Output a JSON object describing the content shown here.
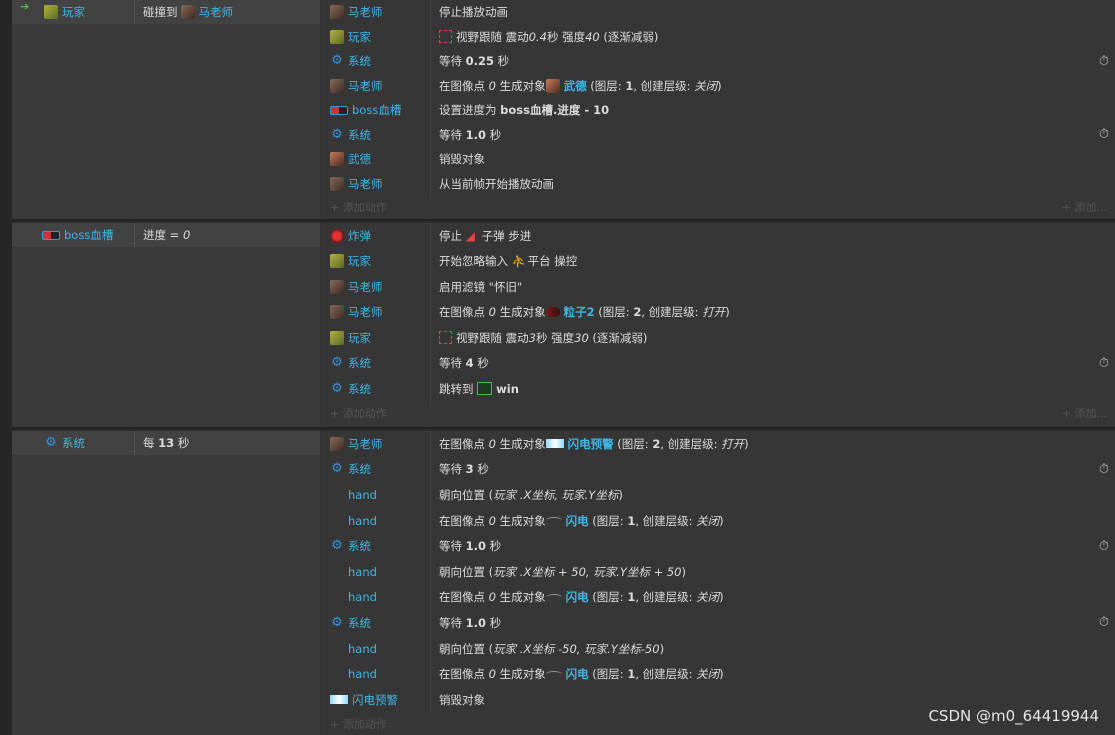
{
  "events": [
    {
      "trigger_object": "玩家",
      "condition_prefix": "碰撞到",
      "condition_object": "马老师",
      "actions": [
        {
          "object": "马老师",
          "icon": "teacher-icon",
          "parts": [
            {
              "t": "停止播放动画"
            }
          ]
        },
        {
          "object": "玩家",
          "icon": "player-icon",
          "parts": [
            {
              "t": "视野跟随 震动"
            },
            {
              "t": "0.4",
              "i": true
            },
            {
              "t": "秒 强度"
            },
            {
              "t": "40",
              "i": true
            },
            {
              "t": " (逐渐减弱)"
            }
          ],
          "lead_icon": "shake-icon"
        },
        {
          "object": "系统",
          "icon": "gear-icon",
          "parts": [
            {
              "t": "等待 "
            },
            {
              "t": "0.25",
              "b": true
            },
            {
              "t": " 秒"
            }
          ],
          "timer": true
        },
        {
          "object": "马老师",
          "icon": "teacher-icon",
          "parts": [
            {
              "t": "在图像点 "
            },
            {
              "t": "0",
              "i": true
            },
            {
              "t": " 生成对象"
            },
            {
              "t": "武德",
              "o": true,
              "icon": "wude-icon"
            },
            {
              "t": " (图层: "
            },
            {
              "t": "1",
              "b": true
            },
            {
              "t": ", 创建层级: "
            },
            {
              "t": "关闭",
              "i": true
            },
            {
              "t": ")"
            }
          ]
        },
        {
          "object": "boss血槽",
          "icon": "boss-bar-icon",
          "parts": [
            {
              "t": "设置进度为 "
            },
            {
              "t": "boss血槽.进度 - 10",
              "b": true
            }
          ]
        },
        {
          "object": "系统",
          "icon": "gear-icon",
          "parts": [
            {
              "t": "等待 "
            },
            {
              "t": "1.0",
              "b": true
            },
            {
              "t": " 秒"
            }
          ],
          "timer": true
        },
        {
          "object": "武德",
          "icon": "wude-icon",
          "parts": [
            {
              "t": "销毁对象"
            }
          ]
        },
        {
          "object": "马老师",
          "icon": "teacher-icon",
          "parts": [
            {
              "t": "从当前帧开始播放动画"
            }
          ]
        }
      ]
    },
    {
      "trigger_object": "boss血槽",
      "condition_prefix": "进度 = ",
      "condition_value": "0",
      "actions": [
        {
          "object": "炸弹",
          "icon": "bomb-icon",
          "parts": [
            {
              "t": "停止 "
            },
            {
              "t": "子弹",
              "icon": "bullet-icon"
            },
            {
              "t": " 步进"
            }
          ]
        },
        {
          "object": "玩家",
          "icon": "player-icon",
          "parts": [
            {
              "t": "开始忽略输入 "
            },
            {
              "t": "平台",
              "icon": "platform-icon"
            },
            {
              "t": " 操控"
            }
          ]
        },
        {
          "object": "马老师",
          "icon": "teacher-icon",
          "parts": [
            {
              "t": "启用滤镜 \"怀旧\""
            }
          ]
        },
        {
          "object": "马老师",
          "icon": "teacher-icon",
          "parts": [
            {
              "t": "在图像点 "
            },
            {
              "t": "0",
              "i": true
            },
            {
              "t": " 生成对象"
            },
            {
              "t": "粒子2",
              "o": true,
              "icon": "particle-icon"
            },
            {
              "t": " (图层: "
            },
            {
              "t": "2",
              "b": true
            },
            {
              "t": ", 创建层级: "
            },
            {
              "t": "打开",
              "i": true
            },
            {
              "t": ")"
            }
          ]
        },
        {
          "object": "玩家",
          "icon": "player-icon",
          "parts": [
            {
              "t": "视野跟随 震动"
            },
            {
              "t": "3",
              "i": true
            },
            {
              "t": "秒 强度"
            },
            {
              "t": "30",
              "i": true
            },
            {
              "t": " (逐渐减弱)"
            }
          ],
          "lead_icon": "shake-icon"
        },
        {
          "object": "系统",
          "icon": "gear-icon",
          "parts": [
            {
              "t": "等待 "
            },
            {
              "t": "4",
              "b": true
            },
            {
              "t": " 秒"
            }
          ],
          "timer": true
        },
        {
          "object": "系统",
          "icon": "gear-icon",
          "parts": [
            {
              "t": "跳转到 "
            },
            {
              "t": "win",
              "b": true,
              "icon": "layout-icon"
            }
          ]
        }
      ]
    },
    {
      "trigger_object": "系统",
      "condition_prefix": "每 ",
      "condition_value": "13",
      "condition_suffix": " 秒",
      "actions": [
        {
          "object": "马老师",
          "icon": "teacher-icon",
          "parts": [
            {
              "t": "在图像点 "
            },
            {
              "t": "0",
              "i": true
            },
            {
              "t": " 生成对象"
            },
            {
              "t": "闪电预警",
              "o": true,
              "icon": "warning-icon"
            },
            {
              "t": " (图层: "
            },
            {
              "t": "2",
              "b": true
            },
            {
              "t": ", 创建层级: "
            },
            {
              "t": "打开",
              "i": true
            },
            {
              "t": ")"
            }
          ]
        },
        {
          "object": "系统",
          "icon": "gear-icon",
          "parts": [
            {
              "t": "等待 "
            },
            {
              "t": "3",
              "b": true
            },
            {
              "t": " 秒"
            }
          ],
          "timer": true
        },
        {
          "object": "hand",
          "icon": "",
          "parts": [
            {
              "t": "朝向位置 ("
            },
            {
              "t": "玩家 .X坐标, 玩家.Y坐标",
              "i": true
            },
            {
              "t": ")"
            }
          ]
        },
        {
          "object": "hand",
          "icon": "",
          "parts": [
            {
              "t": "在图像点 "
            },
            {
              "t": "0",
              "i": true
            },
            {
              "t": " 生成对象"
            },
            {
              "t": "闪电",
              "o": true,
              "icon": "lightning-icon"
            },
            {
              "t": " (图层: "
            },
            {
              "t": "1",
              "b": true
            },
            {
              "t": ", 创建层级: "
            },
            {
              "t": "关闭",
              "i": true
            },
            {
              "t": ")"
            }
          ]
        },
        {
          "object": "系统",
          "icon": "gear-icon",
          "parts": [
            {
              "t": "等待 "
            },
            {
              "t": "1.0",
              "b": true
            },
            {
              "t": " 秒"
            }
          ],
          "timer": true
        },
        {
          "object": "hand",
          "icon": "",
          "parts": [
            {
              "t": "朝向位置 ("
            },
            {
              "t": "玩家 .X坐标 + 50, 玩家.Y坐标 + 50",
              "i": true
            },
            {
              "t": ")"
            }
          ]
        },
        {
          "object": "hand",
          "icon": "",
          "parts": [
            {
              "t": "在图像点 "
            },
            {
              "t": "0",
              "i": true
            },
            {
              "t": " 生成对象"
            },
            {
              "t": "闪电",
              "o": true,
              "icon": "lightning-icon"
            },
            {
              "t": " (图层: "
            },
            {
              "t": "1",
              "b": true
            },
            {
              "t": ", 创建层级: "
            },
            {
              "t": "关闭",
              "i": true
            },
            {
              "t": ")"
            }
          ]
        },
        {
          "object": "系统",
          "icon": "gear-icon",
          "parts": [
            {
              "t": "等待 "
            },
            {
              "t": "1.0",
              "b": true
            },
            {
              "t": " 秒"
            }
          ],
          "timer": true
        },
        {
          "object": "hand",
          "icon": "",
          "parts": [
            {
              "t": "朝向位置 ("
            },
            {
              "t": "玩家 .X坐标 -50, 玩家.Y坐标-50",
              "i": true
            },
            {
              "t": ")"
            }
          ]
        },
        {
          "object": "hand",
          "icon": "",
          "parts": [
            {
              "t": "在图像点 "
            },
            {
              "t": "0",
              "i": true
            },
            {
              "t": " 生成对象"
            },
            {
              "t": "闪电",
              "o": true,
              "icon": "lightning-icon"
            },
            {
              "t": " (图层: "
            },
            {
              "t": "1",
              "b": true
            },
            {
              "t": ", 创建层级: "
            },
            {
              "t": "关闭",
              "i": true
            },
            {
              "t": ")"
            }
          ]
        },
        {
          "object": "闪电预警",
          "icon": "warning-icon",
          "parts": [
            {
              "t": "销毁对象"
            }
          ]
        }
      ]
    }
  ],
  "add_action_label": "+ 添加动作",
  "add_label": "+ 添加...",
  "watermark": "CSDN @m0_64419944",
  "colors": {
    "object_name": "#3fb6e6",
    "background": "#333333",
    "condition_bg": "#424242"
  }
}
